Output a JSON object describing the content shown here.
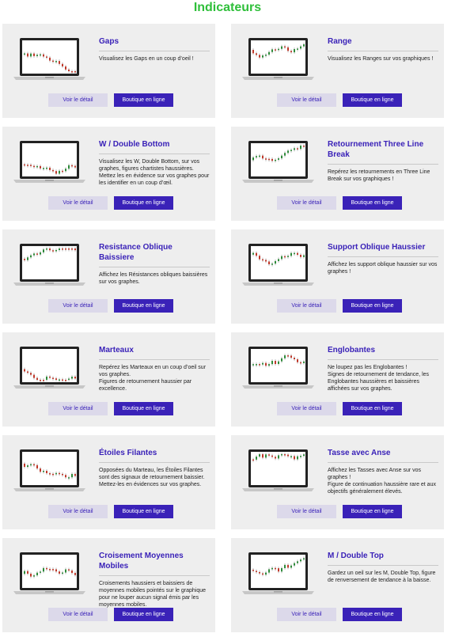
{
  "page": {
    "title": "Indicateurs"
  },
  "buttons": {
    "detail": "Voir le détail",
    "shop": "Boutique en ligne"
  },
  "cards": [
    {
      "title": "Gaps",
      "desc": "Visualisez les Gaps en un coup d’oeil !",
      "thumbnail": "laptop-chart-icon"
    },
    {
      "title": "Range",
      "desc": "Visualisez les Ranges sur vos graphiques !",
      "thumbnail": "laptop-chart-icon"
    },
    {
      "title": "W / Double Bottom",
      "desc": "Visualisez les W, Double Bottom, sur vos graphes, figures chartistes haussières.\nMettez les en évidence sur vos graphes pour les identifier en un coup d’œil.",
      "thumbnail": "laptop-chart-icon"
    },
    {
      "title": "Retournement Three Line Break",
      "desc": "Repérez les retournements en Three Line Break sur vos graphiques !",
      "thumbnail": "laptop-chart-icon"
    },
    {
      "title": "Resistance Oblique Baissiere",
      "desc": "Affichez les Résistances obliques baissières sur vos graphes.",
      "thumbnail": "laptop-chart-icon"
    },
    {
      "title": "Support Oblique Haussier",
      "desc": "Affichez les support oblique haussier sur vos graphes !",
      "thumbnail": "laptop-chart-icon"
    },
    {
      "title": "Marteaux",
      "desc": "Repérez les Marteaux en un coup d’oeil sur vos graphes.\nFigures de retournement haussier par excellence.",
      "thumbnail": "laptop-chart-icon"
    },
    {
      "title": "Englobantes",
      "desc": "Ne loupez pas les Englobantes !\nSignes de retournement de tendance, les Englobantes haussières et baissières affichées sur vos graphes.",
      "thumbnail": "laptop-chart-icon"
    },
    {
      "title": "Étoiles Filantes",
      "desc": "Opposées du Marteau, les Étoiles Filantes sont des signaux de retournement baissier.\nMettez-les en évidences sur vos graphes.",
      "thumbnail": "laptop-chart-icon"
    },
    {
      "title": "Tasse avec Anse",
      "desc": "Affichez les Tasses avec Anse sur vos graphes !\nFigure de continuation haussière rare et aux objectifs généralement élevés.",
      "thumbnail": "laptop-chart-icon"
    },
    {
      "title": "Croisement Moyennes Mobiles",
      "desc": "Croisements haussiers et baissiers de moyennes mobiles pointés sur le graphique pour ne louper aucun signal émis par les moyennes mobiles.",
      "thumbnail": "laptop-chart-icon"
    },
    {
      "title": "M / Double Top",
      "desc": "Gardez un oeil sur les M, Double Top, figure de renversement de tendance à la baisse.",
      "thumbnail": "laptop-chart-icon"
    }
  ]
}
